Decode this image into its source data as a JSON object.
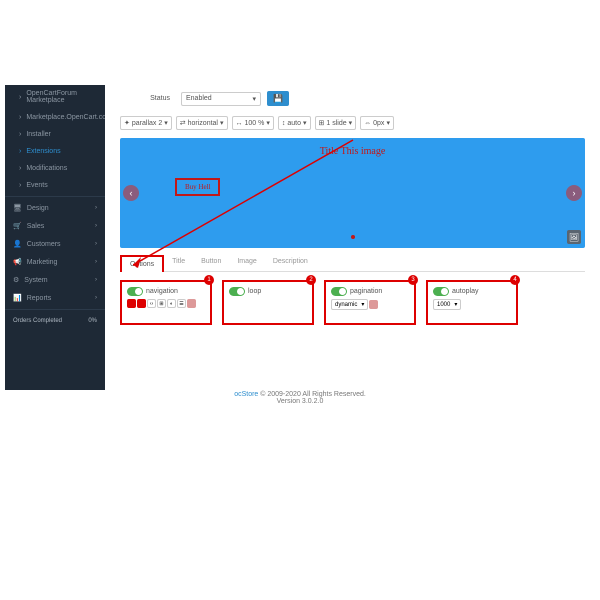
{
  "sidebar": {
    "groups": [
      {
        "label": "OpenCartForum Marketplace"
      },
      {
        "label": "Marketplace.OpenCart.com"
      },
      {
        "label": "Installer"
      },
      {
        "label": "Extensions",
        "active": true
      },
      {
        "label": "Modifications"
      },
      {
        "label": "Events"
      }
    ],
    "main": [
      {
        "icon": "🖥",
        "label": "Design"
      },
      {
        "icon": "🛒",
        "label": "Sales"
      },
      {
        "icon": "👤",
        "label": "Customers"
      },
      {
        "icon": "📢",
        "label": "Marketing"
      },
      {
        "icon": "⚙",
        "label": "System"
      },
      {
        "icon": "📊",
        "label": "Reports"
      }
    ],
    "stat": {
      "label": "Orders Completed",
      "value": "0%"
    }
  },
  "status": {
    "label": "Status",
    "value": "Enabled"
  },
  "toolbar": {
    "effect": "parallax 2",
    "direction": "horizontal",
    "width": "100 %",
    "height": "auto",
    "slides": "1 slide",
    "space": "0px"
  },
  "preview": {
    "title": "Title This image",
    "button": "Buy Hell"
  },
  "tabs": [
    "Options",
    "Title",
    "Button",
    "Image",
    "Description"
  ],
  "options": {
    "nav": {
      "num": "1",
      "label": "navigation"
    },
    "loop": {
      "num": "2",
      "label": "loop"
    },
    "pag": {
      "num": "3",
      "label": "pagination",
      "value": "dynamic"
    },
    "auto": {
      "num": "4",
      "label": "autoplay",
      "value": "1000"
    }
  },
  "footer": {
    "brand": "ocStore",
    "text": " © 2009-2020 All Rights Reserved.",
    "version": "Version 3.0.2.0"
  }
}
